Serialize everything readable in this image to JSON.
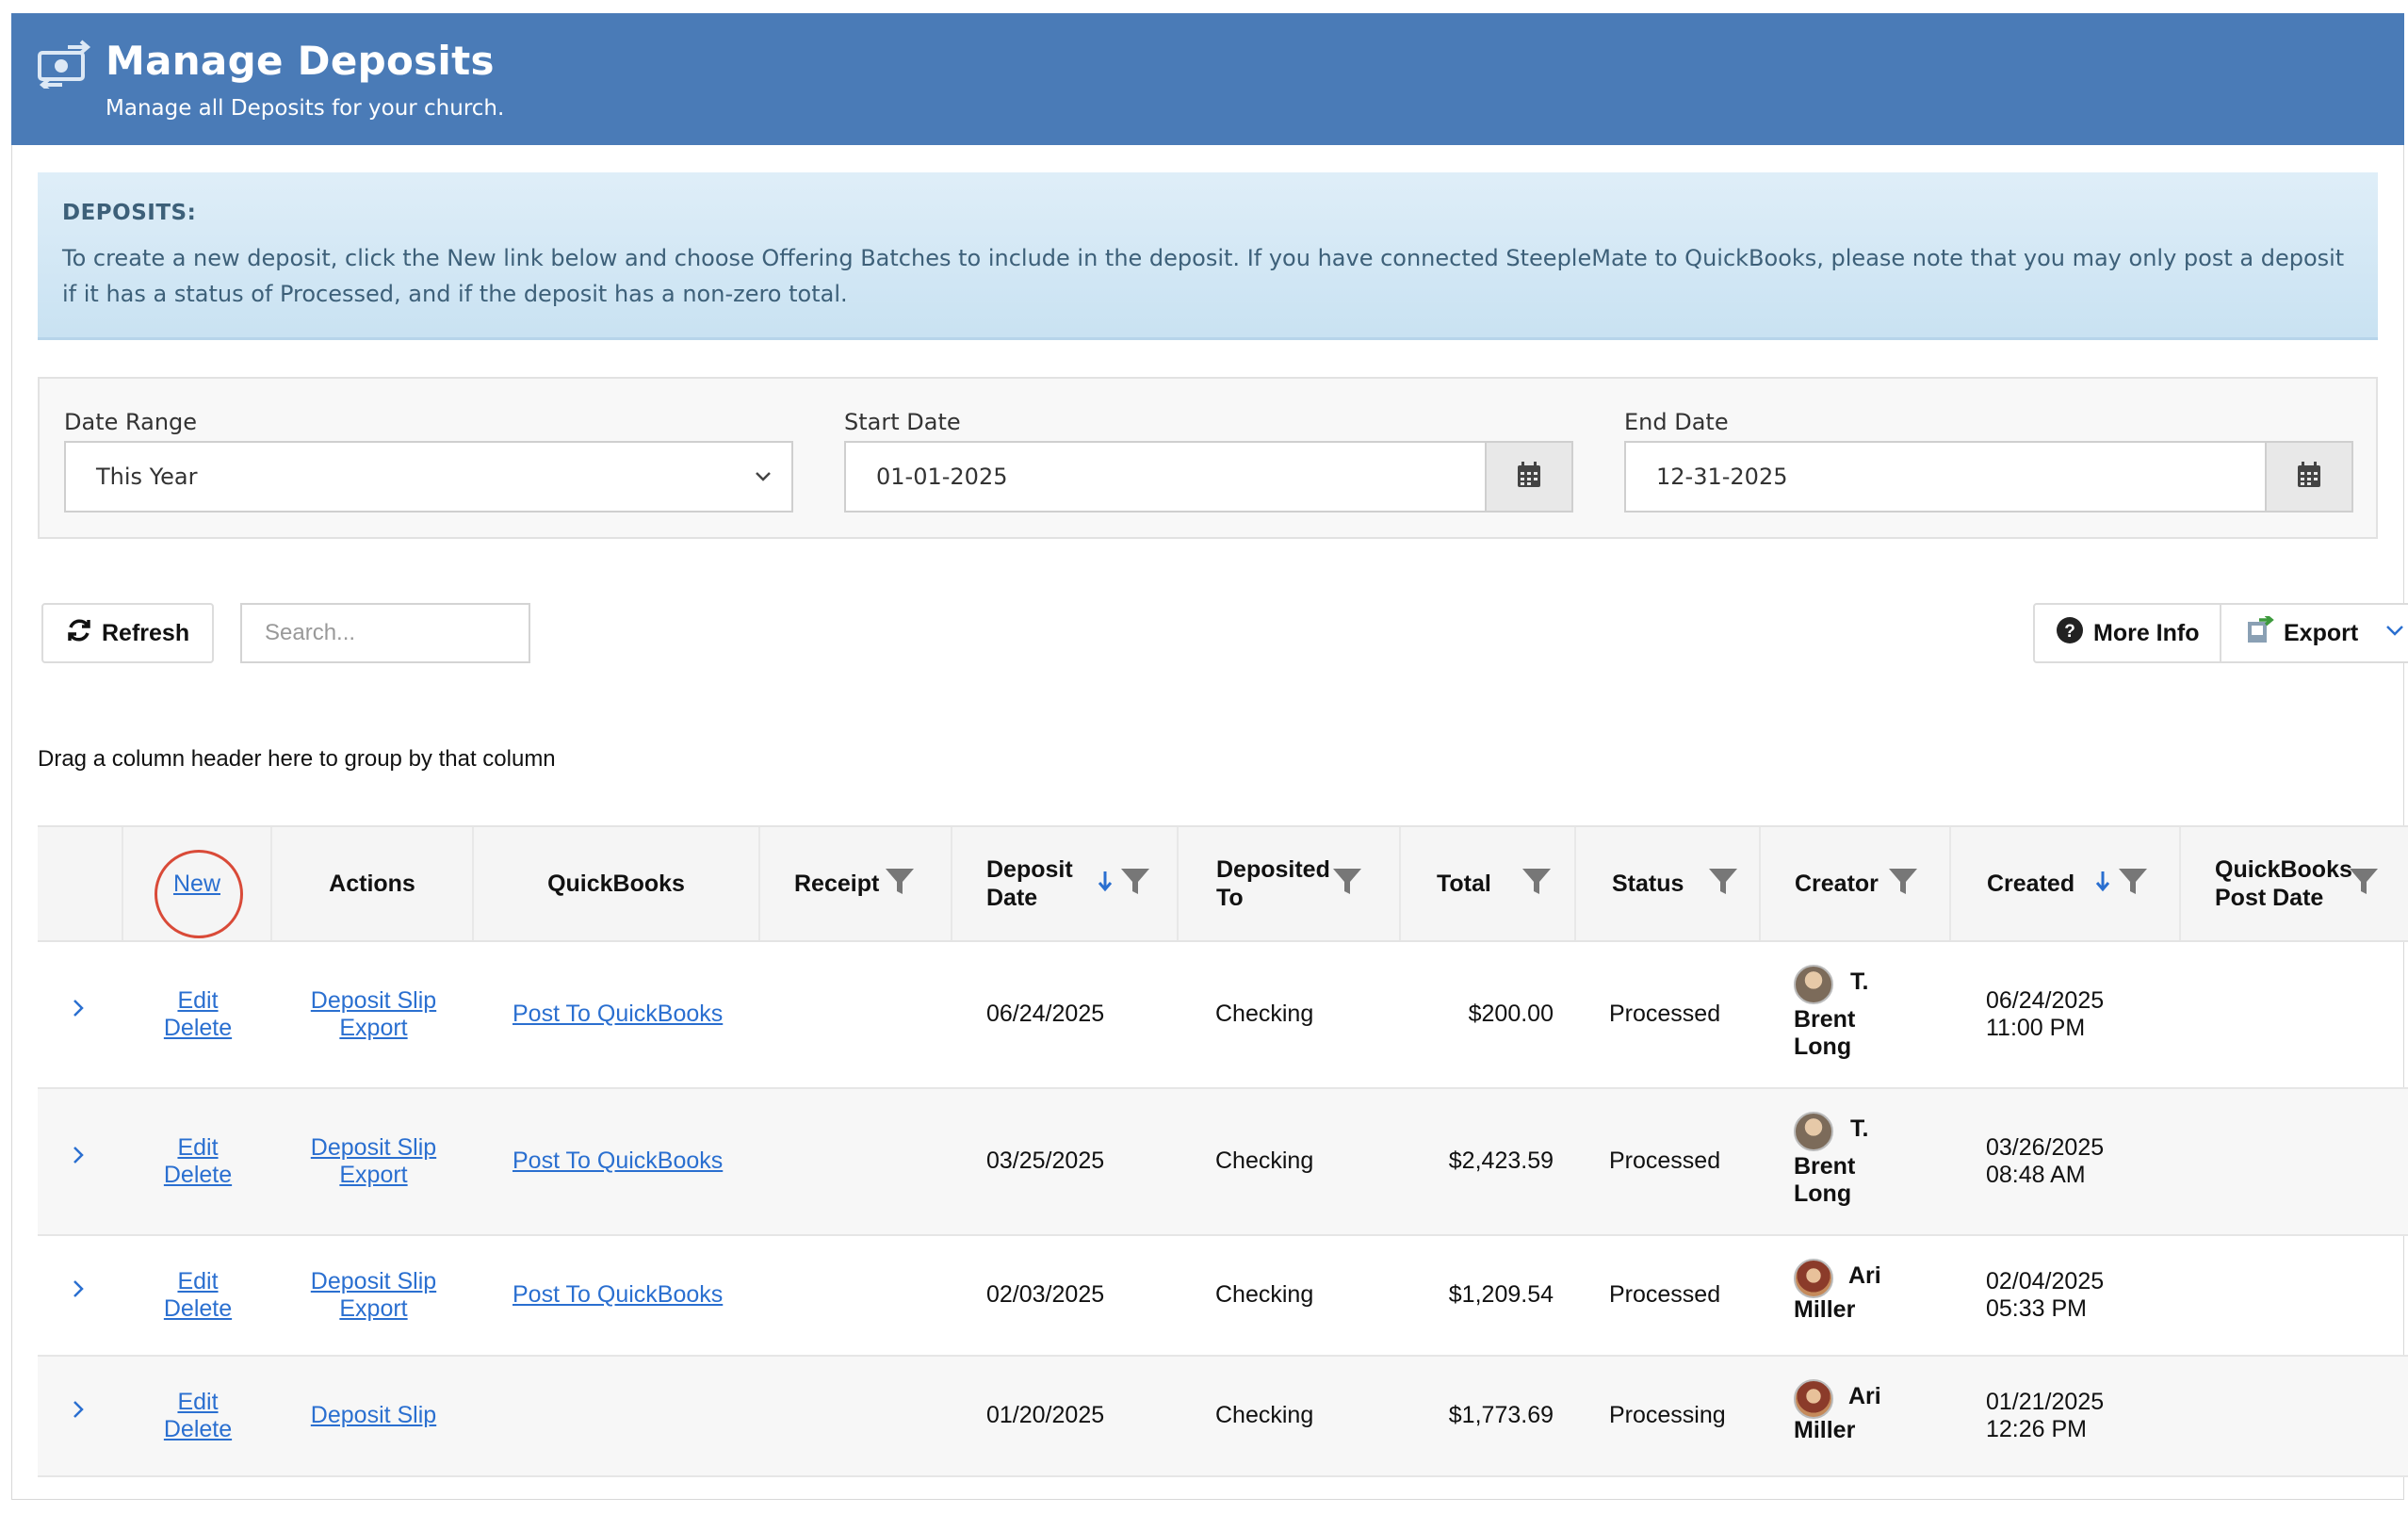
{
  "header": {
    "title": "Manage Deposits",
    "subtitle": "Manage all Deposits for your church."
  },
  "info": {
    "title": "DEPOSITS:",
    "text": "To create a new deposit, click the New link below and choose Offering Batches to include in the deposit. If you have connected SteepleMate to QuickBooks, please note that you may only post a deposit if it has a status of Processed, and if the deposit has a non-zero total."
  },
  "filters": {
    "date_range_label": "Date Range",
    "date_range_value": "This Year",
    "start_label": "Start Date",
    "start_value": "01-01-2025",
    "end_label": "End Date",
    "end_value": "12-31-2025"
  },
  "toolbar": {
    "refresh_label": "Refresh",
    "search_placeholder": "Search...",
    "more_info_label": "More Info",
    "export_label": "Export"
  },
  "group_hint": "Drag a column header here to group by that column",
  "columns": {
    "new": "New",
    "actions": "Actions",
    "quickbooks": "QuickBooks",
    "receipt": "Receipt",
    "deposit_date_1": "Deposit",
    "deposit_date_2": "Date",
    "deposited_to_1": "Deposited",
    "deposited_to_2": "To",
    "total": "Total",
    "status": "Status",
    "creator": "Creator",
    "created": "Created",
    "qb_post_1": "QuickBooks",
    "qb_post_2": "Post Date"
  },
  "rows": [
    {
      "edit": "Edit",
      "delete": "Delete",
      "slip": "Deposit Slip",
      "export": "Export",
      "qb": "Post To QuickBooks",
      "date": "06/24/2025",
      "to": "Checking",
      "total": "$200.00",
      "status": "Processed",
      "creator_1": "T.",
      "creator_2": "Brent",
      "creator_3": "Long",
      "created_date": "06/24/2025",
      "created_time": "11:00 PM"
    },
    {
      "edit": "Edit",
      "delete": "Delete",
      "slip": "Deposit Slip",
      "export": "Export",
      "qb": "Post To QuickBooks",
      "date": "03/25/2025",
      "to": "Checking",
      "total": "$2,423.59",
      "status": "Processed",
      "creator_1": "T.",
      "creator_2": "Brent",
      "creator_3": "Long",
      "created_date": "03/26/2025",
      "created_time": "08:48 AM"
    },
    {
      "edit": "Edit",
      "delete": "Delete",
      "slip": "Deposit Slip",
      "export": "Export",
      "qb": "Post To QuickBooks",
      "date": "02/03/2025",
      "to": "Checking",
      "total": "$1,209.54",
      "status": "Processed",
      "creator_1": "Ari",
      "creator_2": "Miller",
      "created_date": "02/04/2025",
      "created_time": "05:33 PM"
    },
    {
      "edit": "Edit",
      "delete": "Delete",
      "slip": "Deposit Slip",
      "date": "01/20/2025",
      "to": "Checking",
      "total": "$1,773.69",
      "status": "Processing",
      "creator_1": "Ari",
      "creator_2": "Miller",
      "created_date": "01/21/2025",
      "created_time": "12:26 PM"
    }
  ],
  "icons": {
    "header": "money-transfer-icon",
    "calendar": "calendar-icon",
    "refresh": "refresh-icon",
    "help": "question-circle-icon",
    "export": "export-file-icon",
    "filter": "filter-funnel-icon",
    "sort": "sort-down-arrow-icon",
    "expand": "chevron-right-icon"
  },
  "colors": {
    "header_bg": "#4a7bb7",
    "link": "#2a6fd0",
    "info_bg": "#d4e8f5",
    "highlight_circle": "#d94a38"
  }
}
